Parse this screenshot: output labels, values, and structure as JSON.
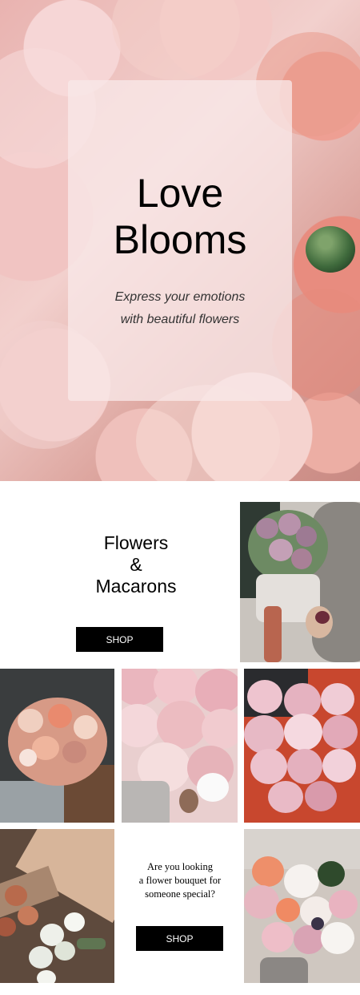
{
  "hero": {
    "title_line1": "Love",
    "title_line2": "Blooms",
    "subtitle_line1": "Express your emotions",
    "subtitle_line2": "with beautiful flowers"
  },
  "feature": {
    "line1": "Flowers",
    "line2": "&",
    "line3": "Macarons",
    "shop_label": "SHOP"
  },
  "promo": {
    "line1": "Are you looking",
    "line2": "a flower bouquet for",
    "line3": "someone special?",
    "shop_label": "SHOP"
  },
  "images": [
    {
      "name": "tulip-bouquet-with-macaron-photo"
    },
    {
      "name": "peach-rose-bouquet-photo"
    },
    {
      "name": "pink-peony-bouquet-photo"
    },
    {
      "name": "peony-armful-photo"
    },
    {
      "name": "dried-flower-arrangement-photo"
    },
    {
      "name": "mixed-peony-bouquet-photo"
    }
  ],
  "colors": {
    "button_bg": "#000000",
    "button_text": "#ffffff",
    "accent_pink": "#f2c8c6"
  }
}
